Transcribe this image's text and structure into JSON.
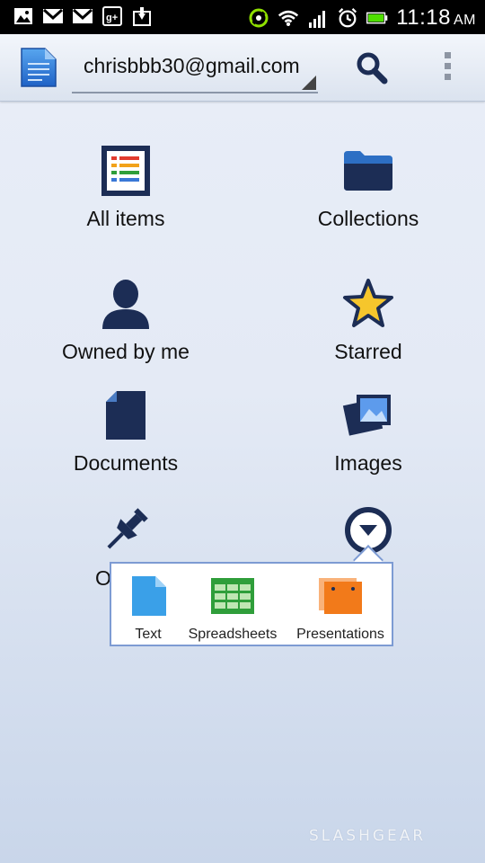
{
  "status_bar": {
    "time": "11:18",
    "ampm": "AM",
    "left_icons": [
      "gallery-icon",
      "gmail-icon",
      "gmail-icon",
      "google-plus-icon",
      "download-icon"
    ],
    "right_icons": [
      "sync-icon",
      "wifi-icon",
      "signal-icon",
      "alarm-icon",
      "battery-icon"
    ]
  },
  "action_bar": {
    "account": "chrisbbb30@gmail.com",
    "search_icon": "search-icon",
    "overflow_icon": "overflow-menu-icon"
  },
  "grid": {
    "all_items": "All items",
    "collections": "Collections",
    "owned_by_me": "Owned by me",
    "starred": "Starred",
    "documents": "Documents",
    "images": "Images",
    "other_partial": "O"
  },
  "popup": {
    "text": "Text",
    "spreadsheets": "Spreadsheets",
    "presentations": "Presentations"
  },
  "watermark": "SLASHGEAR",
  "colors": {
    "accent_navy": "#1c2d55",
    "popup_border": "#7d9bd3",
    "text_doc_blue": "#3aa0e8",
    "sheet_green": "#2f9e3a",
    "slides_orange": "#f27a1a"
  }
}
